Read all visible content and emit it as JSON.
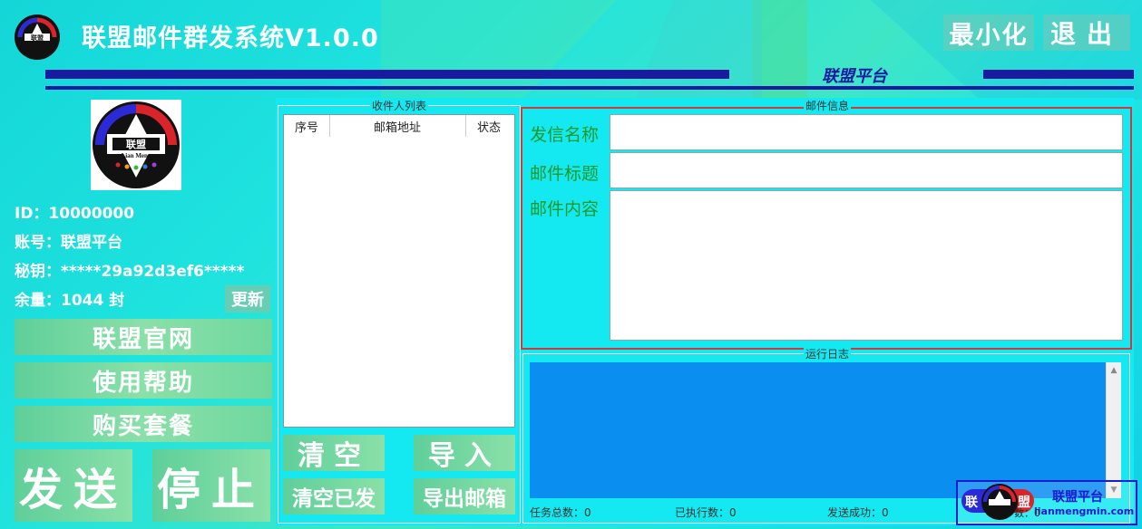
{
  "app": {
    "title": "联盟邮件群发系统V1.0.0",
    "brand": "联盟平台"
  },
  "window_controls": {
    "minimize": "最小化",
    "exit": "退出"
  },
  "logo": {
    "top_text": "联盟",
    "bottom_text": "Lian Meng"
  },
  "account": {
    "id_label": "ID：",
    "id_value": "10000000",
    "account_label": "账号：",
    "account_value": "联盟平台",
    "key_label": "秘钥：",
    "key_value": "*****29a92d3ef6*****",
    "balance_label": "余量：",
    "balance_value": "1044 封",
    "update_button": "更新"
  },
  "sidebar": {
    "items": [
      {
        "label": "联盟官网"
      },
      {
        "label": "使用帮助"
      },
      {
        "label": "购买套餐"
      }
    ],
    "send_button": "发送",
    "stop_button": "停止"
  },
  "recipients": {
    "group_title": "收件人列表",
    "columns": [
      "序号",
      "邮箱地址",
      "状态"
    ],
    "rows": [],
    "clear_button": "清空",
    "import_button": "导入",
    "clear_sent_button": "清空已发",
    "export_button": "导出邮箱"
  },
  "mail_info": {
    "group_title": "邮件信息",
    "sender_label": "发信名称",
    "sender_value": "",
    "subject_label": "邮件标题",
    "subject_value": "",
    "content_label": "邮件内容",
    "content_value": ""
  },
  "log": {
    "group_title": "运行日志",
    "total_label": "任务总数：0",
    "executed_label": "已执行数：0",
    "success_label": "发送成功：0",
    "fail_label": "数：0"
  },
  "watermark": {
    "left_text": "联",
    "right_text": "盟",
    "brand": "联盟平台",
    "url": "lianmengmin.com"
  },
  "colors": {
    "accent_blue": "#1a1aa0",
    "button_green": "#6fd89f",
    "log_bg": "#0a8ef0",
    "label_green": "#1a9a2a",
    "highlight_red": "#d03a3a"
  }
}
